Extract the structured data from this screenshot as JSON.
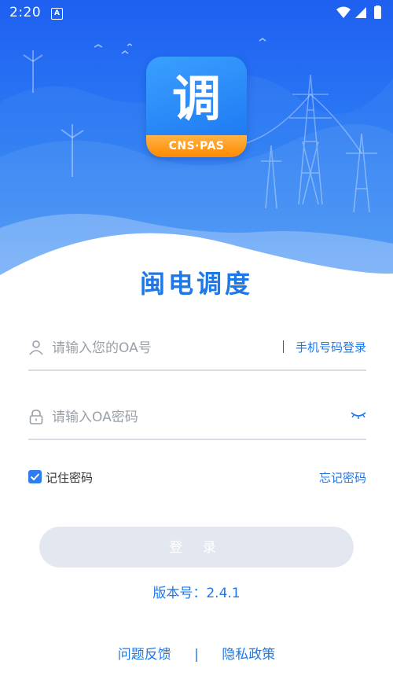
{
  "status_bar": {
    "time": "2:20",
    "notification_icon": "a-icon"
  },
  "logo": {
    "glyph": "调",
    "badge": "CNS·PAS"
  },
  "app_title": "闽电调度",
  "login_form": {
    "account_placeholder": "请输入您的OA号",
    "phone_login_link": "手机号码登录",
    "password_placeholder": "请输入OA密码",
    "remember_label": "记住密码",
    "remember_checked": true,
    "forgot_link": "忘记密码",
    "login_button": "登 录"
  },
  "version_text": "版本号：2.4.1",
  "footer": {
    "feedback": "问题反馈",
    "divider": "|",
    "privacy": "隐私政策"
  },
  "colors": {
    "accent": "#1f78e8",
    "hero_top": "#1e5ff0",
    "button_disabled": "#e3e8f0"
  }
}
